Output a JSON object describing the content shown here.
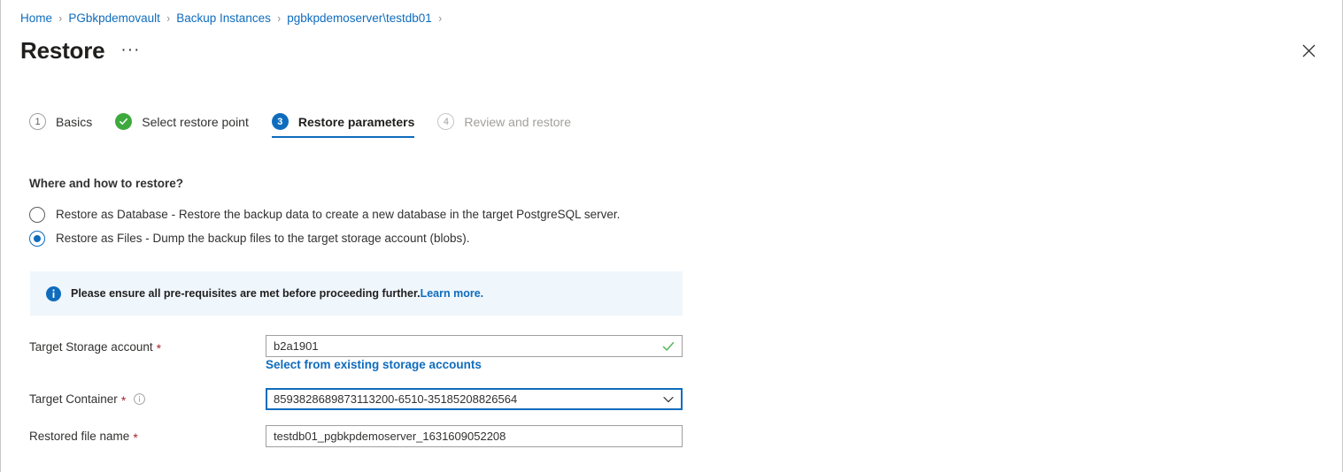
{
  "breadcrumb": {
    "separator": "›",
    "items": [
      {
        "label": "Home"
      },
      {
        "label": "PGbkpdemovault"
      },
      {
        "label": "Backup Instances"
      },
      {
        "label": "pgbkpdemoserver\\testdb01"
      }
    ]
  },
  "header": {
    "title": "Restore",
    "more_label": "···",
    "close_icon": "close-icon"
  },
  "wizard": {
    "steps": [
      {
        "badge": "1",
        "label": "Basics",
        "state": "idle"
      },
      {
        "badge": "✓",
        "label": "Select restore point",
        "state": "done"
      },
      {
        "badge": "3",
        "label": "Restore parameters",
        "state": "current"
      },
      {
        "badge": "4",
        "label": "Review and restore",
        "state": "future"
      }
    ]
  },
  "section": {
    "heading": "Where and how to restore?",
    "options": [
      {
        "label": "Restore as Database - Restore the backup data to create a new database in the target PostgreSQL server.",
        "checked": false
      },
      {
        "label": "Restore as Files - Dump the backup files to the target storage account (blobs).",
        "checked": true
      }
    ]
  },
  "info_banner": {
    "icon": "info-icon",
    "message": "Please ensure all pre-requisites are met before proceeding further.",
    "link_text": "Learn more."
  },
  "form": {
    "storage_account": {
      "label": "Target Storage account",
      "required_marker": "*",
      "value": "b2a1901",
      "placeholder": "",
      "validation_icon": "checkmark-icon",
      "link": "Select from existing storage accounts"
    },
    "container": {
      "label": "Target Container",
      "required_marker": "*",
      "info_icon": "info-circle-icon",
      "value": "8593828689873113200-6510-35185208826564",
      "placeholder": "",
      "chevron_icon": "chevron-down-icon"
    },
    "file_name": {
      "label": "Restored file name",
      "required_marker": "*",
      "value": "testdb01_pgbkpdemoserver_1631609052208",
      "placeholder": ""
    }
  },
  "colors": {
    "accent_blue": "#0f6cbd",
    "success_green": "#3caa3c",
    "required_red": "#a4262c",
    "banner_bg": "#eff6fc",
    "text_primary": "#323130",
    "border_gray": "#a19f9d"
  }
}
